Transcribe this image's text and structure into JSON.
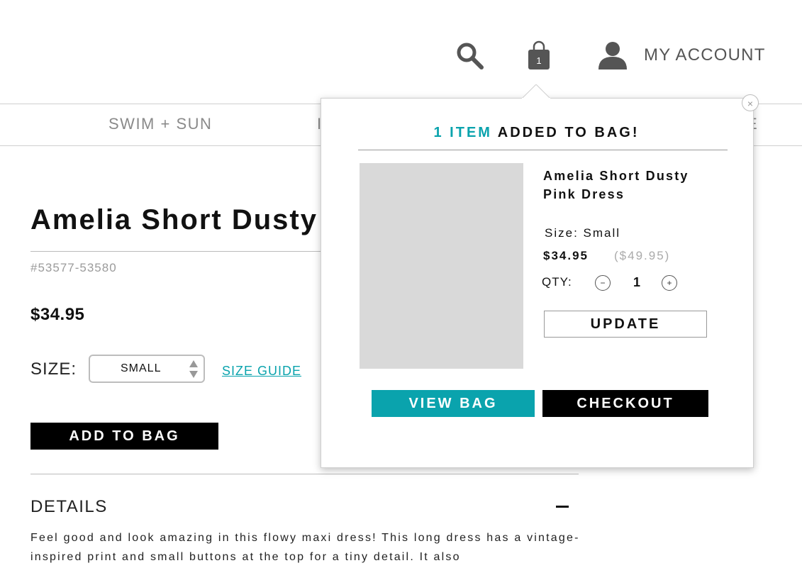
{
  "header": {
    "my_account": "MY ACCOUNT",
    "bag_count": "1",
    "icons": [
      "search-icon",
      "bag-icon",
      "account-icon"
    ]
  },
  "nav": {
    "swim": "SWIM + SUN",
    "partial_left": "I",
    "partial_right": "E"
  },
  "product": {
    "title": "Amelia Short Dusty Pink Dress",
    "sku": "#53577-53580",
    "price": "$34.95",
    "size_label": "SIZE:",
    "size_value": "SMALL",
    "size_guide": "SIZE GUIDE",
    "add_to_bag": "ADD TO BAG",
    "details_heading": "DETAILS",
    "details_text": "Feel good and look amazing in this flowy maxi dress! This long dress has a vintage-inspired print and small buttons at the top for a tiny detail. It also"
  },
  "popup": {
    "count_text": "1 ITEM",
    "added_text": "ADDED TO BAG!",
    "close": "×",
    "item_name": "Amelia Short Dusty Pink Dress",
    "size_text": "Size: Small",
    "price": "$34.95",
    "original_price": "($49.95)",
    "qty_label": "QTY:",
    "qty_minus": "−",
    "qty_value": "1",
    "qty_plus": "+",
    "update": "UPDATE",
    "view_bag": "VIEW BAG",
    "checkout": "CHECKOUT"
  },
  "colors": {
    "accent": "#0aa3ad",
    "text": "#111111",
    "muted": "#8a8a8a",
    "image_placeholder": "#d9d9d9"
  }
}
